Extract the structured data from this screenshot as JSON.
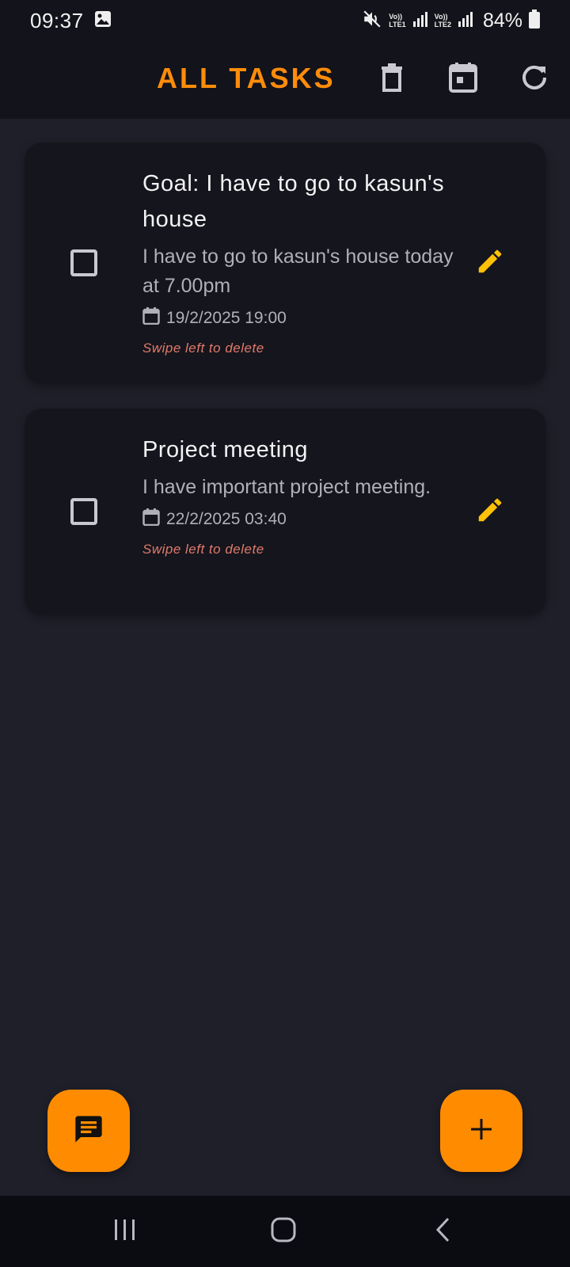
{
  "status_bar": {
    "time": "09:37",
    "battery": "84%",
    "sim1_label_top": "Vo))",
    "sim1_label_bottom": "LTE1",
    "sim2_label_top": "Vo))",
    "sim2_label_bottom": "LTE2",
    "icons": [
      "gallery-icon",
      "mute-icon",
      "signal-icon",
      "battery-icon"
    ]
  },
  "app_bar": {
    "title": "ALL TASKS",
    "actions": [
      "delete-icon",
      "calendar-icon",
      "refresh-icon"
    ],
    "title_color": "#ff8c0a"
  },
  "tasks": [
    {
      "title": "Goal: I have to go to kasun's house",
      "description": "I have to go to kasun's house today at 7.00pm",
      "date": "19/2/2025 19:00",
      "hint": "Swipe left to delete",
      "checked": false
    },
    {
      "title": "Project meeting",
      "description": "I have important project meeting.",
      "date": "22/2/2025 03:40",
      "hint": "Swipe left to delete",
      "checked": false
    }
  ],
  "fabs": [
    "chat-icon",
    "add-icon"
  ],
  "colors": {
    "accent": "#ff8c00",
    "edit_icon": "#ffc107",
    "hint": "#e07a6a",
    "background": "#1f1f2a",
    "card": "#15151d"
  }
}
